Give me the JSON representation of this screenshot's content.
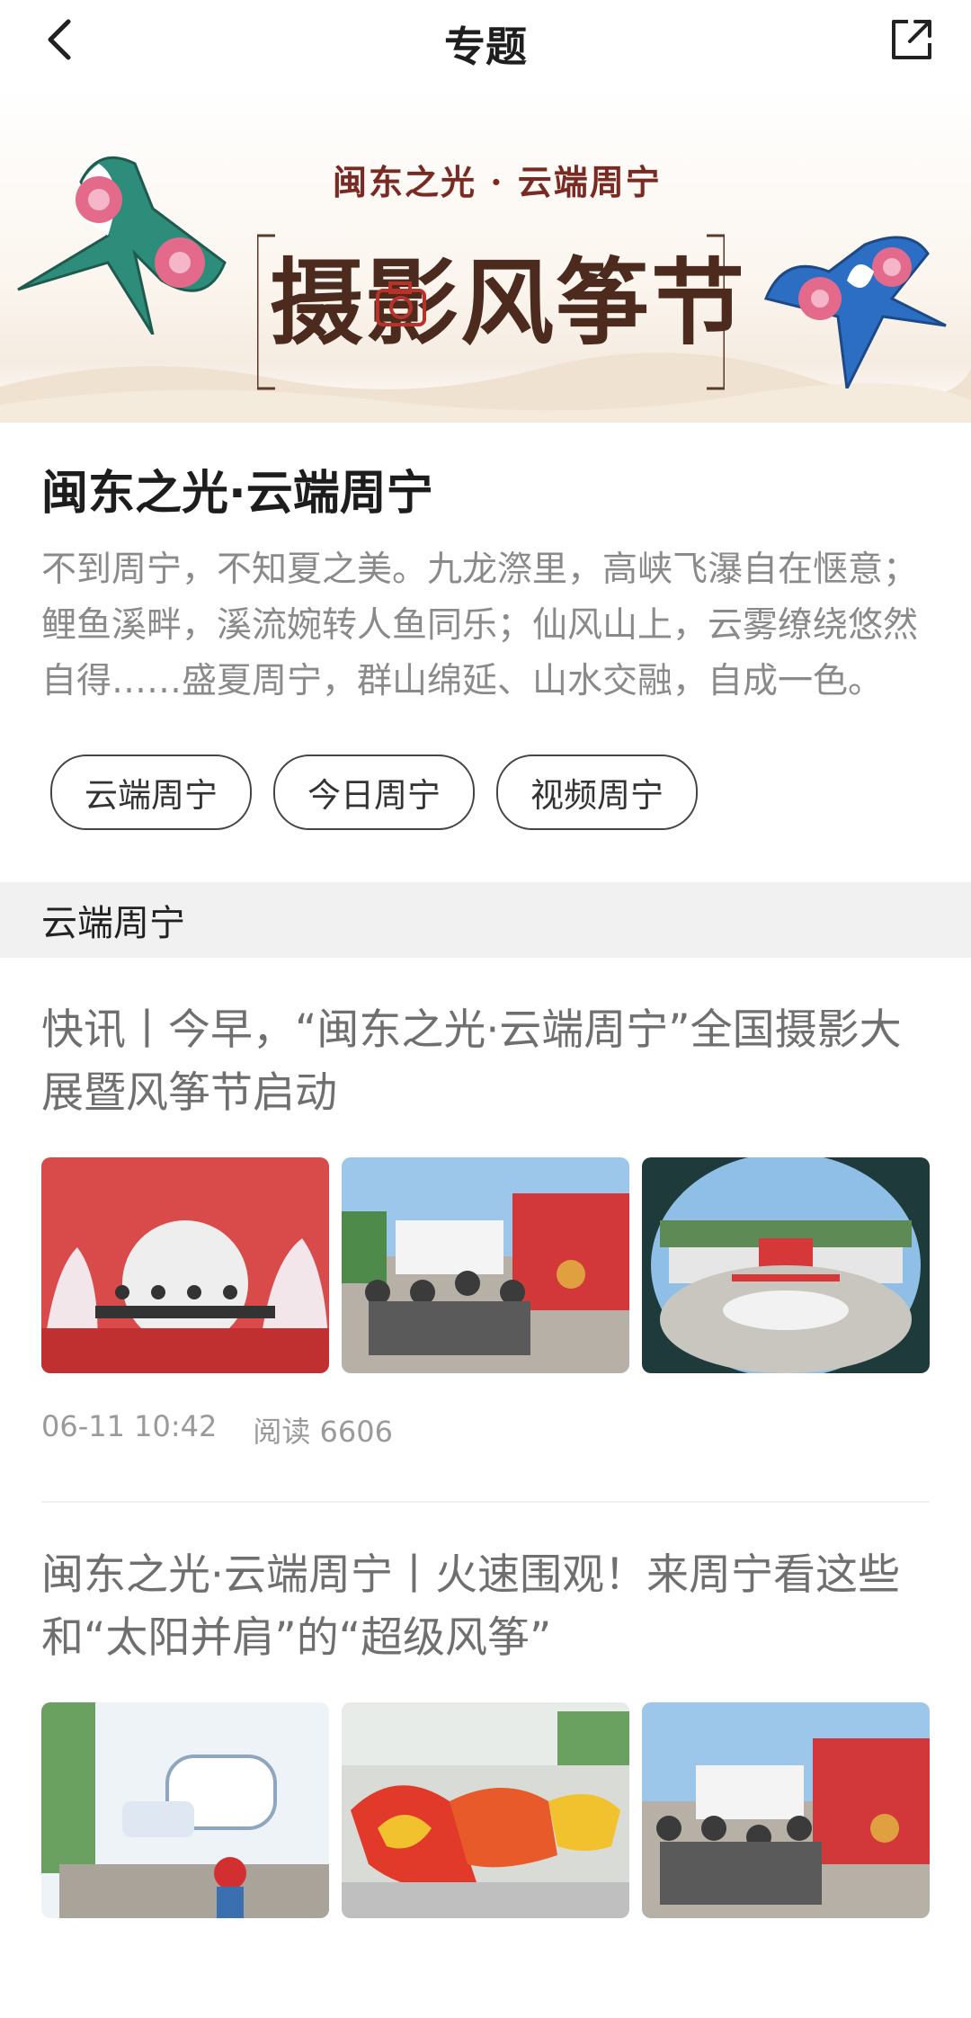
{
  "header": {
    "title": "专题"
  },
  "banner": {
    "subtitle": "闽东之光 · 云端周宁",
    "main_text": "摄影风筝节"
  },
  "intro": {
    "heading": "闽东之光·云端周宁",
    "description": "不到周宁，不知夏之美。九龙漈里，高峡飞瀑自在惬意；鲤鱼溪畔，溪流婉转人鱼同乐；仙风山上，云雾缭绕悠然自得……盛夏周宁，群山绵延、山水交融，自成一色。"
  },
  "tags": [
    "云端周宁",
    "今日周宁",
    "视频周宁"
  ],
  "section": {
    "title": "云端周宁"
  },
  "articles": [
    {
      "headline": "快讯丨今早，“闽东之光·云端周宁”全国摄影大展暨风筝节启动",
      "date": "06-11 10:42",
      "reads": "阅读 6606"
    },
    {
      "headline": "闽东之光·云端周宁丨火速围观！来周宁看这些和“太阳并肩”的“超级风筝”"
    }
  ],
  "colors": {
    "brand_red": "#d93a3a",
    "text_gray": "#8a8a8a"
  }
}
